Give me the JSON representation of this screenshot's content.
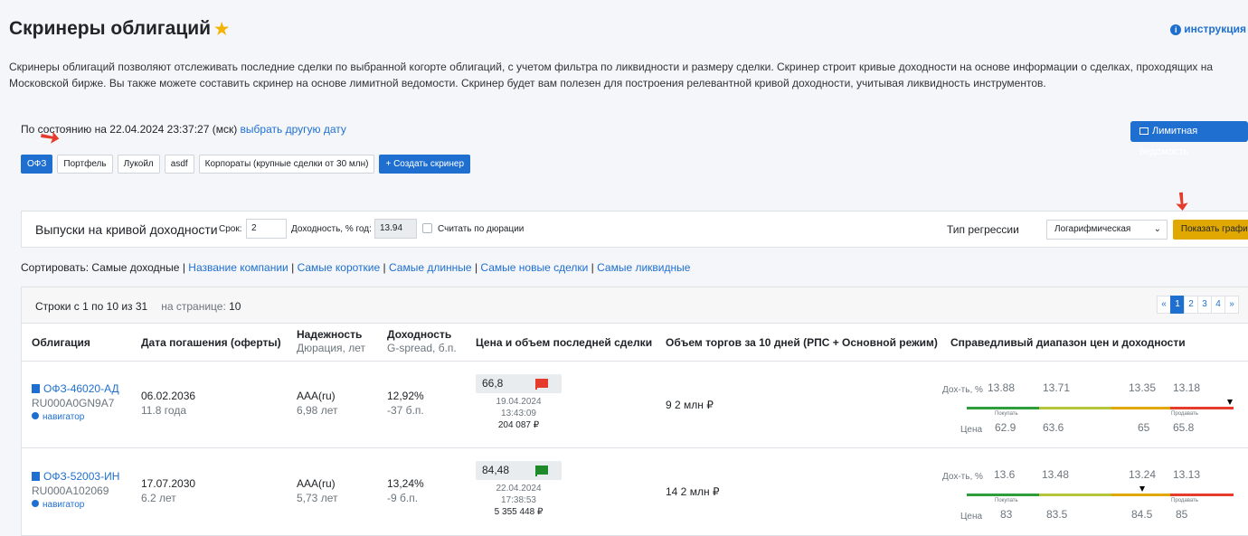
{
  "page_title": "Скринеры облигаций",
  "help_link": "инструкция",
  "description": "Скринеры облигаций позволяют отслеживать последние сделки по выбранной когорте облигаций, с учетом фильтра по ликвидности и размеру сделки. Скринер строит кривые доходности на основе информации о сделках, проходящих на Московской бирже. Вы также можете составить скринер на основе лимитной ведомости. Скринер будет вам полезен для построения релевантной кривой доходности, учитывая ликвидность инструментов.",
  "as_of_text": "По состоянию на 22.04.2024 23:37:27 (мск)",
  "as_of_link": "выбрать другую дату",
  "limit_button": "Лимитная ведомость",
  "tabs": [
    {
      "label": "ОФЗ",
      "active": true
    },
    {
      "label": "Портфель"
    },
    {
      "label": "Лукойл"
    },
    {
      "label": "asdf"
    },
    {
      "label": "Корпораты (крупные сделки от 30 млн)"
    }
  ],
  "create_button": "+ Создать скринер",
  "curve": {
    "title": "Выпуски на кривой доходности",
    "term_label": "Срок:",
    "term_value": "2",
    "yield_label": "Доходность, % год:",
    "yield_value": "13.94",
    "duration_label": "Считать по дюрации",
    "regression_label": "Тип регрессии",
    "regression_value": "Логарифмическая",
    "show_button": "Показать график"
  },
  "sort": {
    "label": "Сортировать:",
    "current": "Самые доходные",
    "options": [
      "Название компании",
      "Самые короткие",
      "Самые длинные",
      "Самые новые сделки",
      "Самые ликвидные"
    ]
  },
  "table": {
    "rows_info": "Строки с 1 по 10 из 31",
    "per_page_label": "на странице:",
    "per_page_value": "10",
    "pager": [
      "«",
      "1",
      "2",
      "3",
      "4",
      "»"
    ],
    "headers": {
      "bond": "Облигация",
      "maturity": "Дата погашения (оферты)",
      "rating": "Надежность",
      "rating_sub": "Дюрация, лет",
      "yield": "Доходность",
      "yield_sub": "G-spread, б.п.",
      "last_deal": "Цена и объем последней сделки",
      "volume": "Объем торгов за 10 дней (РПС + Основной режим)",
      "range": "Справедливый диапазон цен и доходности"
    },
    "range_labels": {
      "yield": "Дох-ть, %",
      "price": "Цена",
      "buy": "Покупать",
      "sell": "Продавать"
    },
    "rows": [
      {
        "name": "ОФЗ-46020-АД",
        "isin": "RU000A0GN9A7",
        "navigator": "навигатор",
        "maturity": "06.02.2036",
        "years": "11.8 года",
        "rating": "AAA(ru)",
        "duration": "6,98 лет",
        "yield": "12,92%",
        "spread": "-37 б.п.",
        "price": "66,8",
        "flag_color": "#e53b2c",
        "date": "19.04.2024",
        "time": "13:43:09",
        "amount": "204 087 ₽",
        "volume": "9 2 млн ₽",
        "yields": [
          "13.88",
          "13.71",
          "13.35",
          "13.18"
        ],
        "prices": [
          "62.9",
          "63.6",
          "65",
          "65.8"
        ],
        "marker_fraction": 0.98
      },
      {
        "name": "ОФЗ-52003-ИН",
        "isin": "RU000A102069",
        "navigator": "навигатор",
        "maturity": "17.07.2030",
        "years": "6.2 лет",
        "rating": "AAA(ru)",
        "duration": "5,73 лет",
        "yield": "13,24%",
        "spread": "-9 б.п.",
        "price": "84,48",
        "flag_color": "#1e8a2a",
        "date": "22.04.2024",
        "time": "17:38:53",
        "amount": "5 355 448 ₽",
        "volume": "14 2 млн ₽",
        "yields": [
          "13.6",
          "13.48",
          "13.24",
          "13.13"
        ],
        "prices": [
          "83",
          "83.5",
          "84.5",
          "85"
        ],
        "marker_fraction": 0.66
      }
    ]
  },
  "colors": {
    "accent": "#1f6fd1",
    "warning": "#e0a800",
    "red": "#e53b2c",
    "green": "#1e8a2a"
  }
}
